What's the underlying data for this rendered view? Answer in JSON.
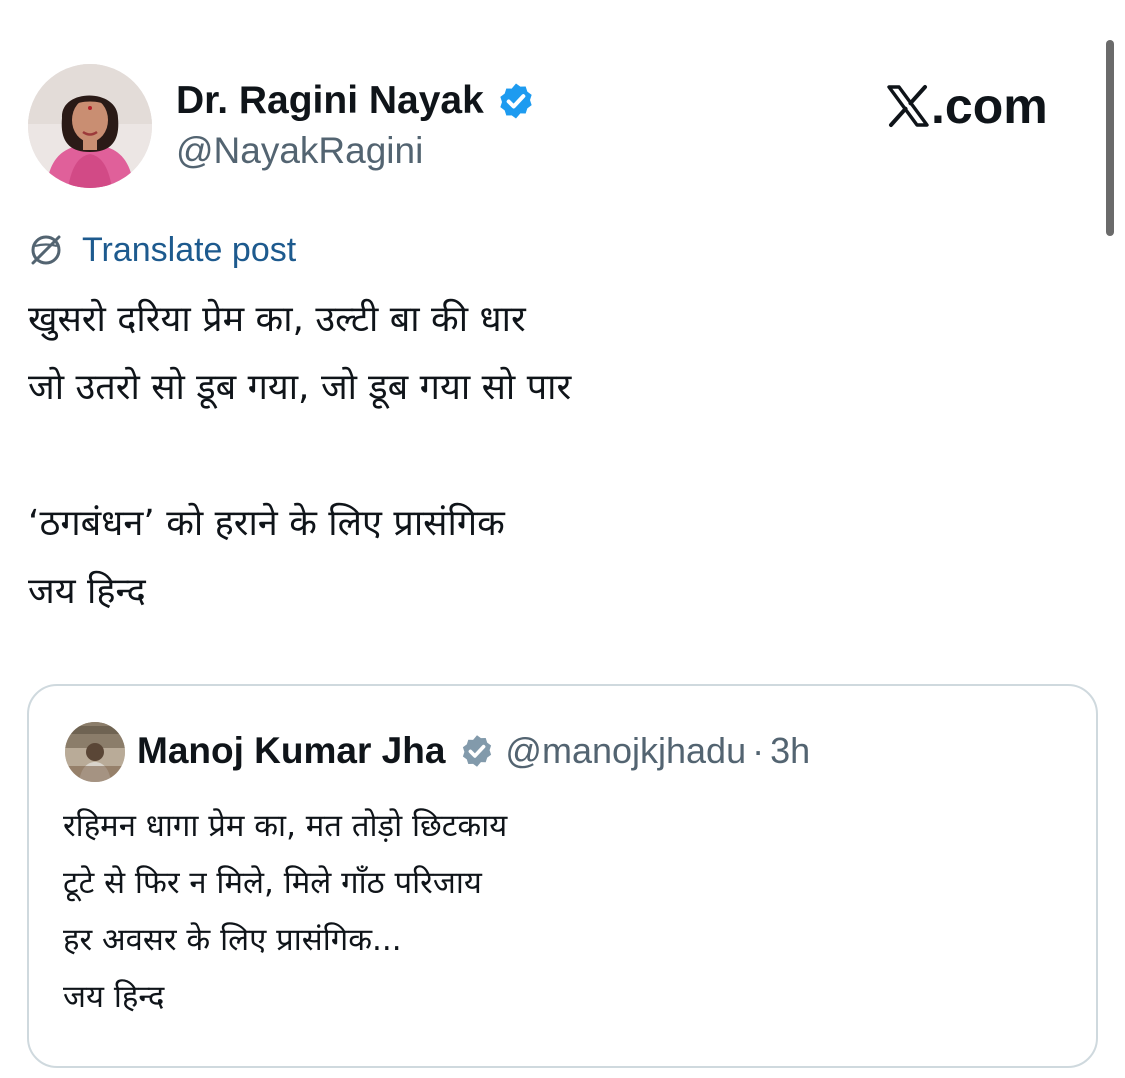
{
  "author": {
    "display_name": "Dr. Ragini Nayak",
    "handle": "@NayakRagini",
    "verified_icon": "verified-badge-icon",
    "verified_color": "#1d9bf0"
  },
  "site": {
    "label": ".com",
    "icon": "x-logo-icon"
  },
  "translate": {
    "label": "Translate post",
    "icon": "translate-globe-icon",
    "color": "#1d5a8e"
  },
  "post": {
    "lines": [
      "खुसरो दरिया प्रेम का, उल्टी बा की धार",
      "जो उतरो सो डूब गया, जो डूब गया सो पार",
      "",
      "‘ठगबंधन’ को हराने के लिए प्रासंगिक",
      "जय हिन्द"
    ]
  },
  "quoted": {
    "display_name": "Manoj Kumar Jha",
    "verified_icon": "verified-badge-icon",
    "verified_color": "#829aab",
    "handle": "@manojkjhadu",
    "separator": "·",
    "time": "3h",
    "lines": [
      "रहिमन धागा प्रेम का, मत तोड़ो छिटकाय",
      "टूटे से फिर न मिले, मिले गाँठ परिजाय",
      "हर अवसर के लिए प्रासंगिक...",
      "जय हिन्द"
    ]
  }
}
